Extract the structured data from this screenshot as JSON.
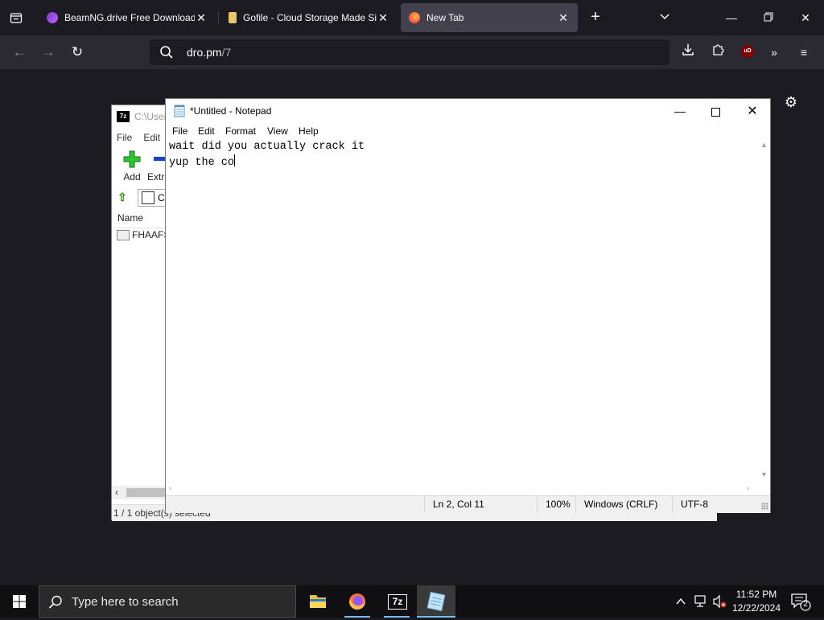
{
  "browser": {
    "tabs": [
      {
        "title": "BeamNG.drive Free Download (",
        "active": false
      },
      {
        "title": "Gofile - Cloud Storage Made Si",
        "active": false
      },
      {
        "title": "New Tab",
        "active": true
      }
    ],
    "url_host": "dro.pm",
    "url_path": "/7",
    "ublock_label": "uD"
  },
  "zip": {
    "title": "C:\\User",
    "logo": "7z",
    "menu": [
      "File",
      "Edit"
    ],
    "tools": {
      "add": "Add",
      "extract": "Extra"
    },
    "address": "C:",
    "column_name": "Name",
    "file_name": "FHAAFS",
    "status": "1 / 1 object(s) selected"
  },
  "notepad": {
    "title": "*Untitled - Notepad",
    "menu": {
      "file": "File",
      "edit": "Edit",
      "format": "Format",
      "view": "View",
      "help": "Help"
    },
    "lines": [
      "wait did you actually crack it",
      "yup the co"
    ],
    "status": {
      "position": "Ln 2, Col 11",
      "zoom": "100%",
      "eol": "Windows (CRLF)",
      "encoding": "UTF-8"
    }
  },
  "taskbar": {
    "search_placeholder": "Type here to search",
    "zip_label": "7z",
    "time": "11:52 PM",
    "date": "12/22/2024",
    "notification_count": "2"
  },
  "colors": {
    "accent": "#76b9ed",
    "browser_bg": "#1c1b22",
    "toolbar": "#2b2a33",
    "active_tab": "#42414d"
  }
}
